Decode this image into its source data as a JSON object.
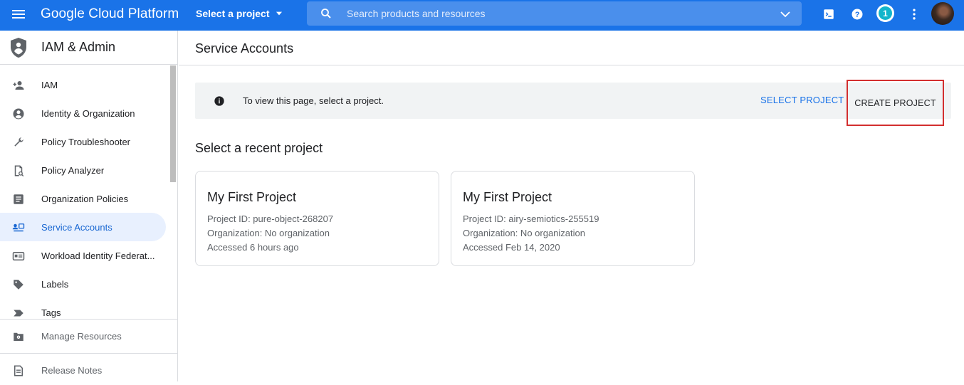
{
  "topbar": {
    "brand": "Google Cloud Platform",
    "project_selector": "Select a project",
    "search_placeholder": "Search products and resources",
    "notification_count": "1"
  },
  "sidebar": {
    "title": "IAM & Admin",
    "items": [
      {
        "label": "IAM",
        "icon": "person-add-icon",
        "active": false
      },
      {
        "label": "Identity & Organization",
        "icon": "account-circle-icon",
        "active": false
      },
      {
        "label": "Policy Troubleshooter",
        "icon": "wrench-icon",
        "active": false
      },
      {
        "label": "Policy Analyzer",
        "icon": "policy-analyzer-icon",
        "active": false
      },
      {
        "label": "Organization Policies",
        "icon": "list-document-icon",
        "active": false
      },
      {
        "label": "Service Accounts",
        "icon": "service-account-icon",
        "active": true
      },
      {
        "label": "Workload Identity Federat...",
        "icon": "id-card-icon",
        "active": false
      },
      {
        "label": "Labels",
        "icon": "label-tag-icon",
        "active": false
      },
      {
        "label": "Tags",
        "icon": "tag-arrow-icon",
        "active": false
      }
    ],
    "footer": {
      "manage_resources": "Manage Resources",
      "release_notes": "Release Notes"
    }
  },
  "main": {
    "page_title": "Service Accounts",
    "banner": {
      "message": "To view this page, select a project.",
      "select_project": "SELECT PROJECT",
      "create_project": "CREATE PROJECT"
    },
    "recent_title": "Select a recent project",
    "projects": [
      {
        "name": "My First Project",
        "project_id": "Project ID: pure-object-268207",
        "organization": "Organization: No organization",
        "accessed": "Accessed 6 hours ago"
      },
      {
        "name": "My First Project",
        "project_id": "Project ID: airy-semiotics-255519",
        "organization": "Organization: No organization",
        "accessed": "Accessed Feb 14, 2020"
      }
    ]
  },
  "colors": {
    "brand_blue": "#1a73e8",
    "active_bg": "#e8f0fe",
    "highlight_red": "#d32f2f"
  }
}
